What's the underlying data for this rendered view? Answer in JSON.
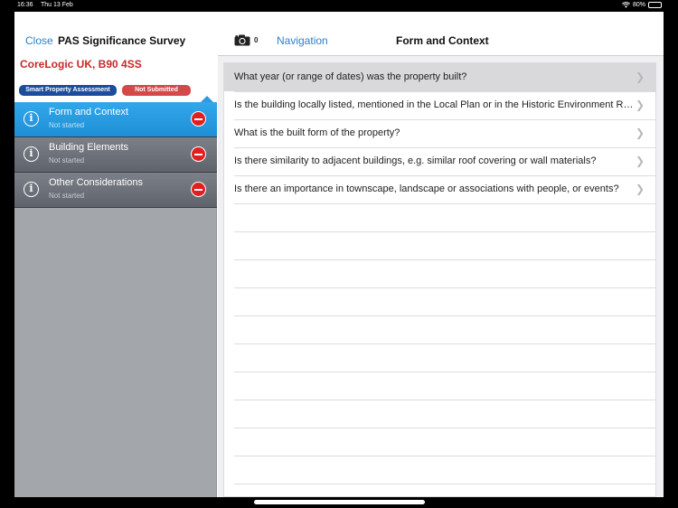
{
  "status_bar": {
    "time": "16:36",
    "date": "Thu 13 Feb",
    "battery": "80%",
    "battery_level": 0.8
  },
  "sidebar": {
    "close_label": "Close",
    "title": "PAS Significance Survey",
    "address": "CoreLogic UK, B90 4SS",
    "badges": {
      "assessment": "Smart Property Assessment",
      "status": "Not Submitted"
    },
    "items": [
      {
        "label": "Form and Context",
        "status": "Not started"
      },
      {
        "label": "Building Elements",
        "status": "Not started"
      },
      {
        "label": "Other Considerations",
        "status": "Not started"
      }
    ]
  },
  "detail": {
    "camera_count": "0",
    "navigation_label": "Navigation",
    "title": "Form and Context",
    "questions": [
      "What year (or range of dates) was the property built?",
      "Is the building locally listed, mentioned in the Local Plan or in the Historic Environment Record?",
      "What is the built form of the property?",
      "Is there similarity to adjacent buildings, e.g. similar roof covering or wall materials?",
      "Is there an importance in townscape, landscape or associations with people, or events?"
    ]
  },
  "icons": {
    "info": "info-circle-icon",
    "remove": "remove-circle-icon",
    "camera": "camera-icon",
    "chevron": "chevron-right-icon",
    "wifi": "wifi-icon",
    "battery": "battery-icon"
  },
  "colors": {
    "accent": "#2a7fce",
    "active_item": "#2a9be0",
    "address_red": "#c62828",
    "badge_blue": "#1c4d9c",
    "badge_red": "#d34949",
    "remove_red": "#e02020"
  }
}
